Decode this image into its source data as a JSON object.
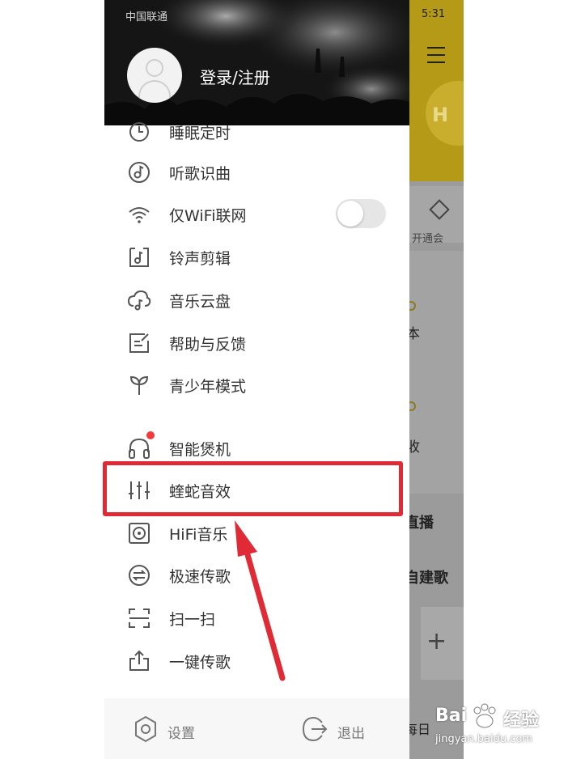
{
  "status_bar": {
    "carrier": "中国联通",
    "time": "5:31"
  },
  "drawer": {
    "login_label": "登录/注册",
    "menu_items": [
      {
        "label": "睡眠定时",
        "icon": "clock-icon"
      },
      {
        "label": "听歌识曲",
        "icon": "music-note-icon"
      },
      {
        "label": "仅WiFi联网",
        "icon": "wifi-icon"
      },
      {
        "label": "铃声剪辑",
        "icon": "ringtone-icon"
      },
      {
        "label": "音乐云盘",
        "icon": "cloud-music-icon"
      },
      {
        "label": "帮助与反馈",
        "icon": "feedback-icon"
      },
      {
        "label": "青少年模式",
        "icon": "sprout-icon"
      },
      {
        "label": "智能煲机",
        "icon": "headphone-icon"
      },
      {
        "label": "蝰蛇音效",
        "icon": "equalizer-icon"
      },
      {
        "label": "HiFi音乐",
        "icon": "speaker-icon"
      },
      {
        "label": "极速传歌",
        "icon": "transfer-icon"
      },
      {
        "label": "扫一扫",
        "icon": "scan-icon"
      },
      {
        "label": "一键传歌",
        "icon": "upload-icon"
      }
    ],
    "wifi_only_enabled": false,
    "bottom_bar": {
      "settings_label": "设置",
      "logout_label": "退出"
    }
  },
  "background_app": {
    "vip_label": "开通会",
    "text_1": "本",
    "text_2": "收",
    "live_label": "直播",
    "playlist_label": "自建歌",
    "bottom_text": "每日"
  },
  "watermark": {
    "brand": "Bai",
    "brand_suffix": "经验",
    "url": "jingyan.baidu.com"
  },
  "colors": {
    "highlight": "#e02a36",
    "badge": "#f23a3a",
    "brand_yellow": "#b59a18"
  }
}
